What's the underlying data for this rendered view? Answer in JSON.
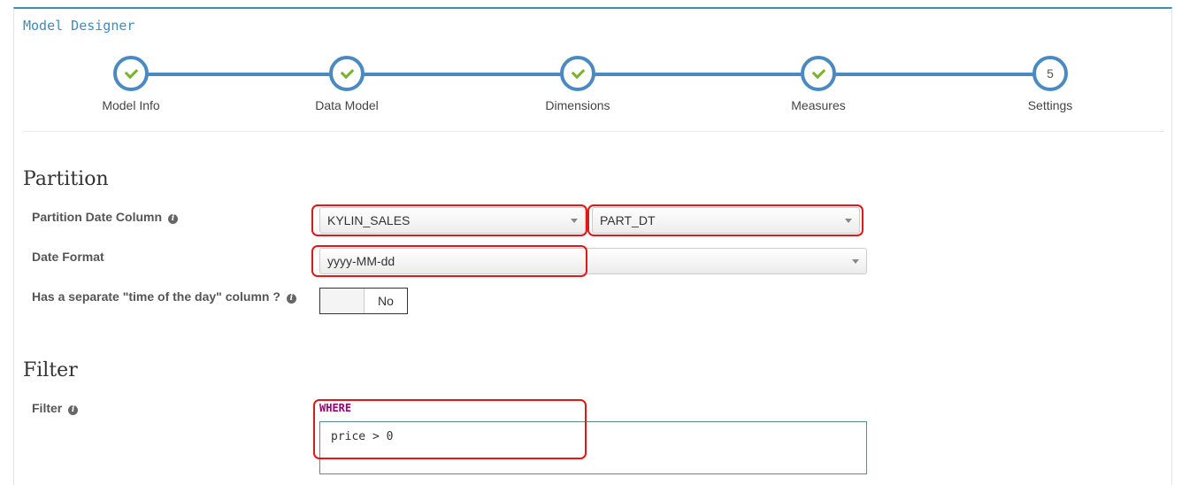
{
  "designer": {
    "title": "Model Designer"
  },
  "wizard": {
    "steps": [
      {
        "label": "Model Info",
        "state": "done"
      },
      {
        "label": "Data Model",
        "state": "done"
      },
      {
        "label": "Dimensions",
        "state": "done"
      },
      {
        "label": "Measures",
        "state": "done"
      },
      {
        "label": "Settings",
        "state": "active",
        "number": "5"
      }
    ]
  },
  "partition": {
    "title": "Partition",
    "date_column_label": "Partition Date Column",
    "table_value": "KYLIN_SALES",
    "column_value": "PART_DT",
    "date_format_label": "Date Format",
    "date_format_value": "yyyy-MM-dd",
    "time_of_day_label": "Has a separate \"time of the day\" column ?",
    "time_of_day_value": "No"
  },
  "filter": {
    "title": "Filter",
    "label": "Filter",
    "keyword": "WHERE",
    "value": "price > 0"
  },
  "icons": {
    "info": "info-icon",
    "check": "check-icon",
    "caret": "caret-down-icon"
  },
  "colors": {
    "accent": "#4a8ac0",
    "check": "#7ab42f",
    "highlight": "#e01818"
  }
}
